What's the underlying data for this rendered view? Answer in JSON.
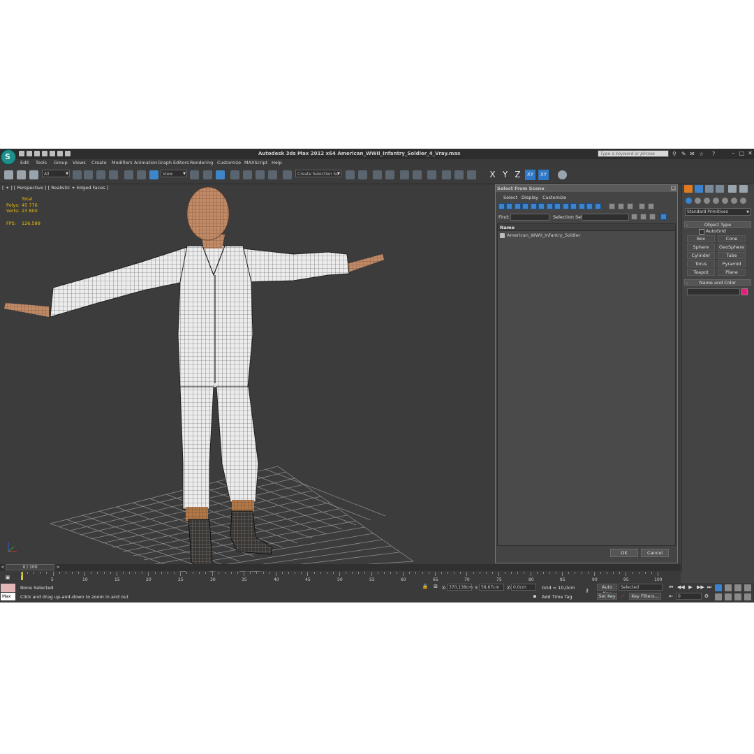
{
  "app": {
    "window_title": "Autodesk 3ds Max  2012 x64      American_WWII_Infantry_Soldier_4_Vray.max",
    "search_placeholder": "Type a keyword or phrase"
  },
  "menu": [
    "Edit",
    "Tools",
    "Group",
    "Views",
    "Create",
    "Modifiers",
    "Animation",
    "Graph Editors",
    "Rendering",
    "Customize",
    "MAXScript",
    "Help"
  ],
  "toolbar": {
    "filter_value": "All",
    "ref_coord": "View",
    "selection_set": "Create Selection Se",
    "axis_x": "X",
    "axis_y": "Y",
    "axis_z": "Z",
    "axis_xy": "XY",
    "axis_xy2": "XY"
  },
  "viewport": {
    "label": "[ + ] [ Perspective ] [ Realistic + Edged Faces ]",
    "stats_total": "Total",
    "polys_label": "Polys:",
    "polys_value": "45 776",
    "verts_label": "Verts:",
    "verts_value": "23 800",
    "fps_label": "FPS:",
    "fps_value": "126,589"
  },
  "dialog": {
    "title": "Select From Scene",
    "menu": [
      "Select",
      "Display",
      "Customize"
    ],
    "find_label": "Find:",
    "selection_set_label": "Selection Set:",
    "column_name": "Name",
    "objects": [
      "American_WWII_Infantry_Soldier"
    ],
    "ok": "OK",
    "cancel": "Cancel"
  },
  "command_panel": {
    "category": "Standard Primitives",
    "object_type_title": "Object Type",
    "autogrid": "AutoGrid",
    "primitives": [
      "Box",
      "Cone",
      "Sphere",
      "GeoSphere",
      "Cylinder",
      "Tube",
      "Torus",
      "Pyramid",
      "Teapot",
      "Plane"
    ],
    "name_color_title": "Name and Color",
    "object_color": "#e0207a"
  },
  "timeline": {
    "slider": "0 / 100",
    "ticks": [
      "5",
      "10",
      "15",
      "20",
      "25",
      "30",
      "35",
      "40",
      "45",
      "50",
      "55",
      "60",
      "65",
      "70",
      "75",
      "80",
      "85",
      "90",
      "95",
      "100"
    ]
  },
  "status": {
    "maxscript": "Max",
    "selection": "None Selected",
    "prompt": "Click and drag up-and-down to zoom in and out",
    "x_label": "X:",
    "x_value": "370,138cm",
    "y_label": "Y:",
    "y_value": "58,67cm",
    "z_label": "Z:",
    "z_value": "0,0cm",
    "grid": "Grid = 10,0cm",
    "add_time_tag": "Add Time Tag",
    "auto_key": "Auto Key",
    "set_key": "Set Key",
    "key_mode": "Selected",
    "key_filters": "Key Filters...",
    "frame": "0"
  }
}
